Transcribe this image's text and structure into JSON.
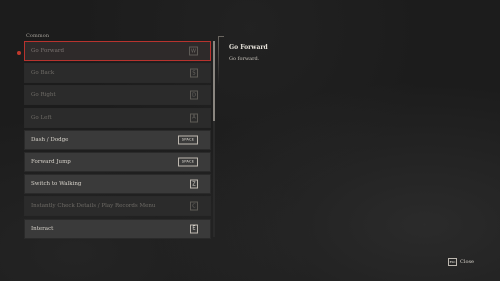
{
  "section_title": "Common",
  "actions": [
    {
      "label": "Go Forward",
      "key": "W",
      "state": "selected"
    },
    {
      "label": "Go Back",
      "key": "S",
      "state": "disabled"
    },
    {
      "label": "Go Right",
      "key": "D",
      "state": "disabled"
    },
    {
      "label": "Go Left",
      "key": "A",
      "state": "disabled"
    },
    {
      "label": "Dash / Dodge",
      "key": "SPACE",
      "state": "normal"
    },
    {
      "label": "Forward Jump",
      "key": "SPACE",
      "state": "normal"
    },
    {
      "label": "Switch to Walking",
      "key": "Z",
      "state": "normal"
    },
    {
      "label": "Instantly Check Details / Play Records Menu",
      "key": "C",
      "state": "disabled"
    },
    {
      "label": "Interact",
      "key": "E",
      "state": "normal"
    }
  ],
  "detail": {
    "title": "Go Forward",
    "description": "Go forward."
  },
  "footer": {
    "key": "ESC",
    "label": "Close"
  },
  "colors": {
    "selection_border": "#b8332e",
    "marker": "#c0392b"
  }
}
